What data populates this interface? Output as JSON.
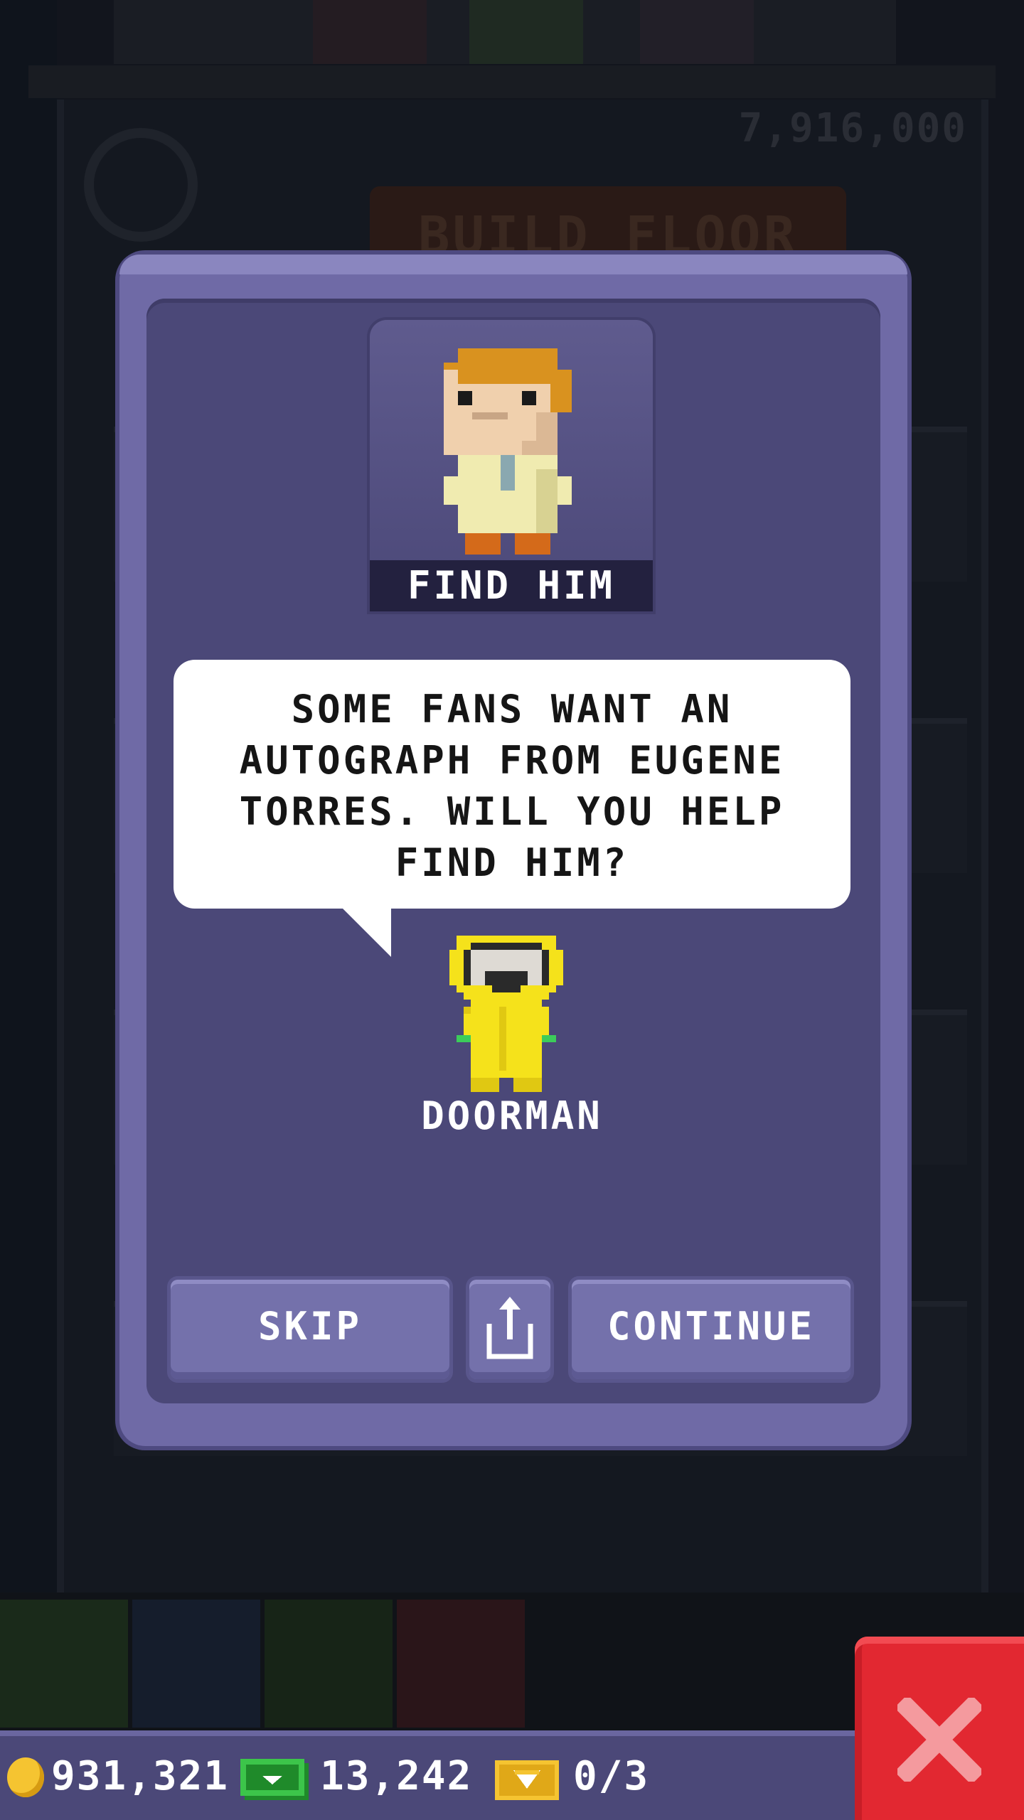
{
  "background": {
    "score_text": "7,916,000",
    "build_floor_label": "BUILD FLOOR"
  },
  "modal": {
    "portrait_label": "FIND HIM",
    "speech_lines": [
      "SOME FANS WANT AN",
      "AUTOGRAPH FROM EUGENE",
      "TORRES. WILL YOU HELP",
      "FIND HIM?"
    ],
    "speaker_name": "DOORMAN",
    "buttons": {
      "skip": "SKIP",
      "share_icon": "share-icon",
      "continue": "CONTINUE"
    }
  },
  "status_bar": {
    "coins": "931,321",
    "bux": "13,242",
    "tickets": "0/3"
  },
  "colors": {
    "modal_frame": "#6f6aa6",
    "modal_inner": "#4b4878",
    "close_button": "#e22831",
    "doorman_yellow": "#f5e21b"
  }
}
